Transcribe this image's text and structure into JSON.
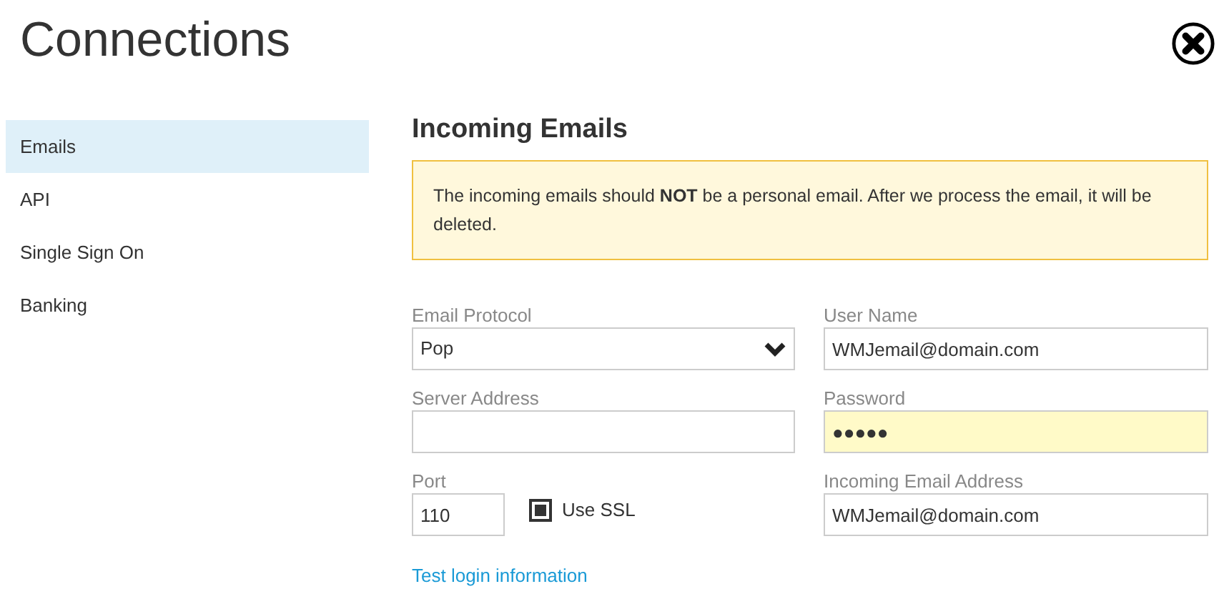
{
  "title": "Connections",
  "sidebar": {
    "items": [
      {
        "label": "Emails",
        "selected": true
      },
      {
        "label": "API",
        "selected": false
      },
      {
        "label": "Single Sign On",
        "selected": false
      },
      {
        "label": "Banking",
        "selected": false
      }
    ]
  },
  "section_title": "Incoming Emails",
  "alert": "The incoming emails should **NOT** be a personal email. After we process the email, it will be deleted.",
  "left_fields": [
    {
      "kind": "select",
      "label": "Email Protocol",
      "value": "Pop"
    },
    {
      "kind": "text",
      "label": "Server Address"
    }
  ],
  "right_fields": [
    {
      "label": "User Name",
      "value": "WMJemail@domain.com",
      "autofilled": false
    },
    {
      "label": "Password",
      "value": "●●●●●",
      "autofilled": true
    },
    {
      "label": "Incoming Email Address",
      "value": "WMJemail@domain.com",
      "autofilled": false
    }
  ],
  "port": {
    "label": "Port",
    "value": "110"
  },
  "use_ssl": {
    "label": "Use SSL",
    "checked": true
  },
  "test_link": "Test login information"
}
